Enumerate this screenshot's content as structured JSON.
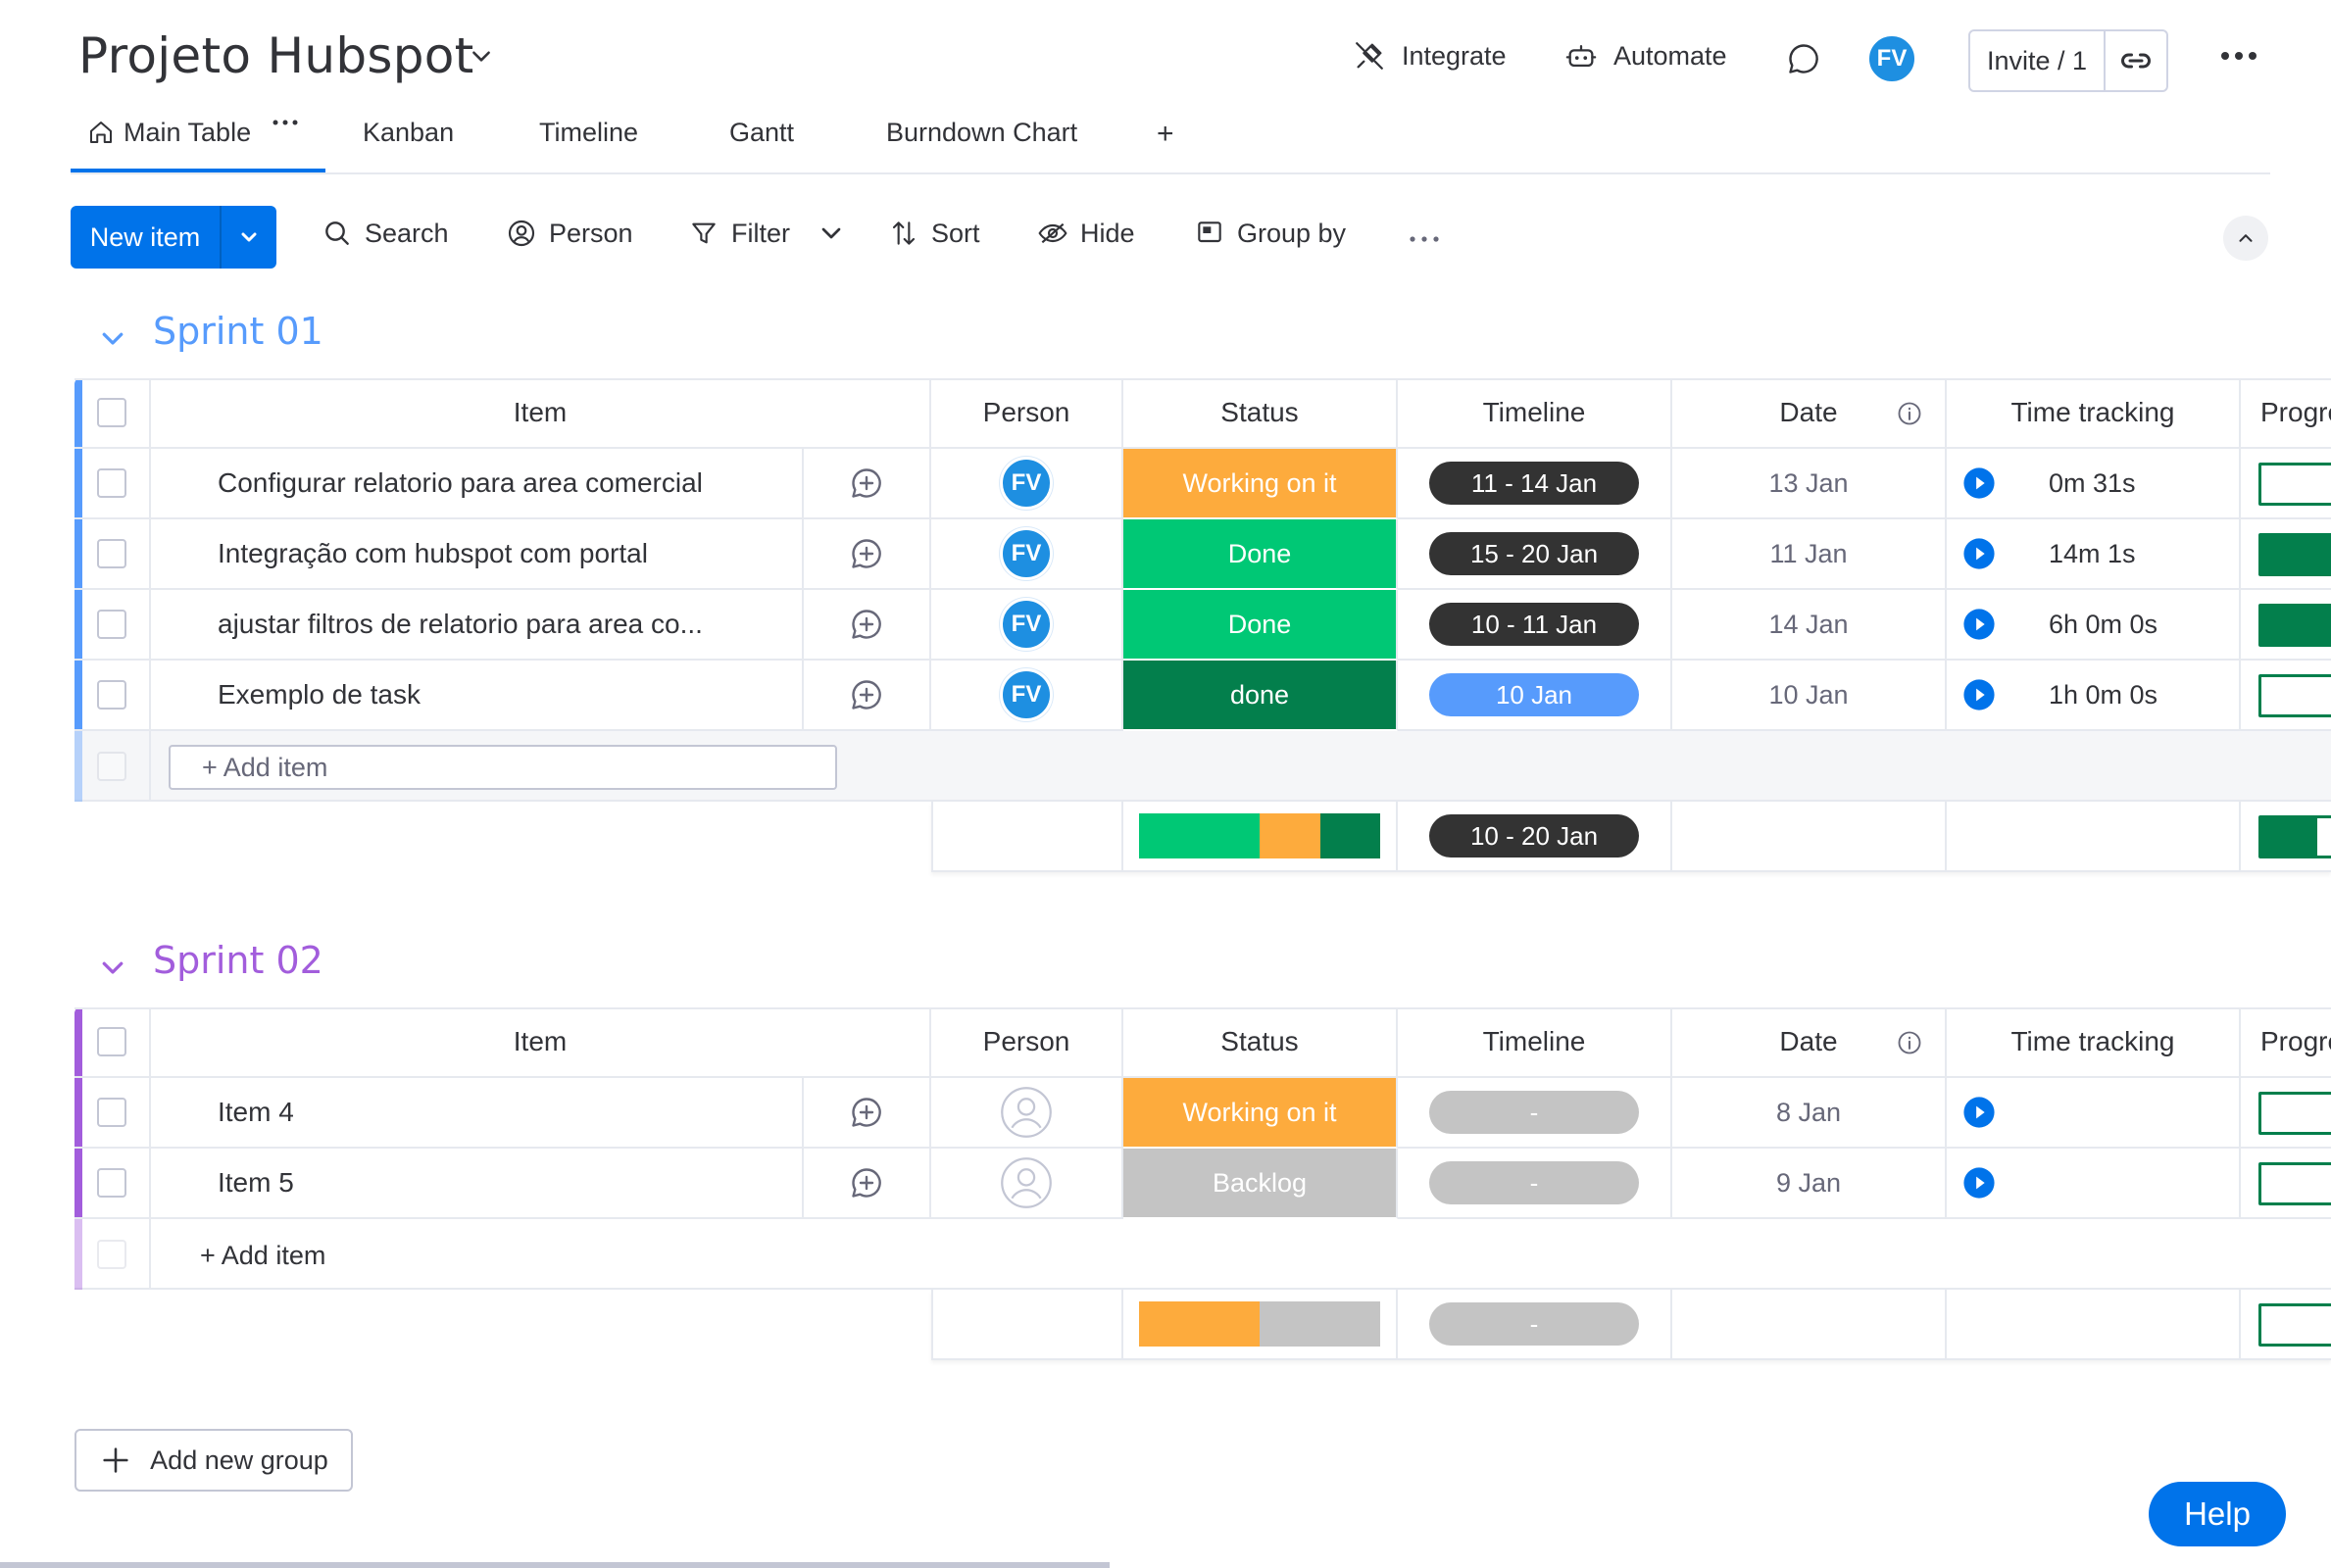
{
  "board": {
    "title": "Projeto Hubspot",
    "integrate_label": "Integrate",
    "automate_label": "Automate",
    "avatar_initials": "FV",
    "invite_label": "Invite / 1"
  },
  "tabs": [
    {
      "label": "Main Table",
      "active": true
    },
    {
      "label": "Kanban"
    },
    {
      "label": "Timeline"
    },
    {
      "label": "Gantt"
    },
    {
      "label": "Burndown Chart"
    },
    {
      "label": "+"
    }
  ],
  "toolbar": {
    "new_item_label": "New item",
    "search_label": "Search",
    "person_label": "Person",
    "filter_label": "Filter",
    "sort_label": "Sort",
    "hide_label": "Hide",
    "group_by_label": "Group by"
  },
  "columns": [
    "Item",
    "Person",
    "Status",
    "Timeline",
    "Date",
    "Time tracking",
    "Progress tr"
  ],
  "colors": {
    "accent": "#0073ea",
    "working_on_it": "#fdab3d",
    "done": "#00c875",
    "done_dark": "#037f4c",
    "backlog": "#c4c4c4",
    "timeline_dark": "#333333",
    "timeline_blue": "#579bfc",
    "sprint1": "#579bfc",
    "sprint2": "#a25ddc"
  },
  "groups": [
    {
      "title": "Sprint 01",
      "add_item_label": "+ Add item",
      "rows": [
        {
          "item": "Configurar relatorio para area comercial",
          "person": "FV",
          "status": "Working on it",
          "timeline": "11 - 14 Jan",
          "date": "13 Jan",
          "time_tracking": "0m 31s",
          "progress": 0
        },
        {
          "item": "Integração com hubspot com portal",
          "person": "FV",
          "status": "Done",
          "timeline": "15 - 20 Jan",
          "date": "11 Jan",
          "time_tracking": "14m 1s",
          "progress": 1
        },
        {
          "item": "ajustar filtros de relatorio para area co...",
          "person": "FV",
          "status": "Done",
          "timeline": "10 - 11 Jan",
          "date": "14 Jan",
          "time_tracking": "6h 0m 0s",
          "progress": 1
        },
        {
          "item": "Exemplo de task",
          "person": "FV",
          "status": "done",
          "timeline": "10 Jan",
          "date": "10 Jan",
          "time_tracking": "1h 0m 0s",
          "progress": 0
        }
      ],
      "summary": {
        "timeline": "10 - 20 Jan",
        "status_split": [
          0.5,
          0.25,
          0.25
        ],
        "progress": 0.5
      }
    },
    {
      "title": "Sprint 02",
      "add_item_label": "+ Add item",
      "rows": [
        {
          "item": "Item 4",
          "person": "",
          "status": "Working on it",
          "timeline": "-",
          "date": "8 Jan",
          "time_tracking": "",
          "progress": 0
        },
        {
          "item": "Item 5",
          "person": "",
          "status": "Backlog",
          "timeline": "-",
          "date": "9 Jan",
          "time_tracking": "",
          "progress": 0
        }
      ],
      "summary": {
        "timeline": "-",
        "status_split": [
          0.5,
          0.5
        ],
        "progress": 0
      }
    }
  ],
  "add_group_label": "Add new group",
  "help_label": "Help"
}
